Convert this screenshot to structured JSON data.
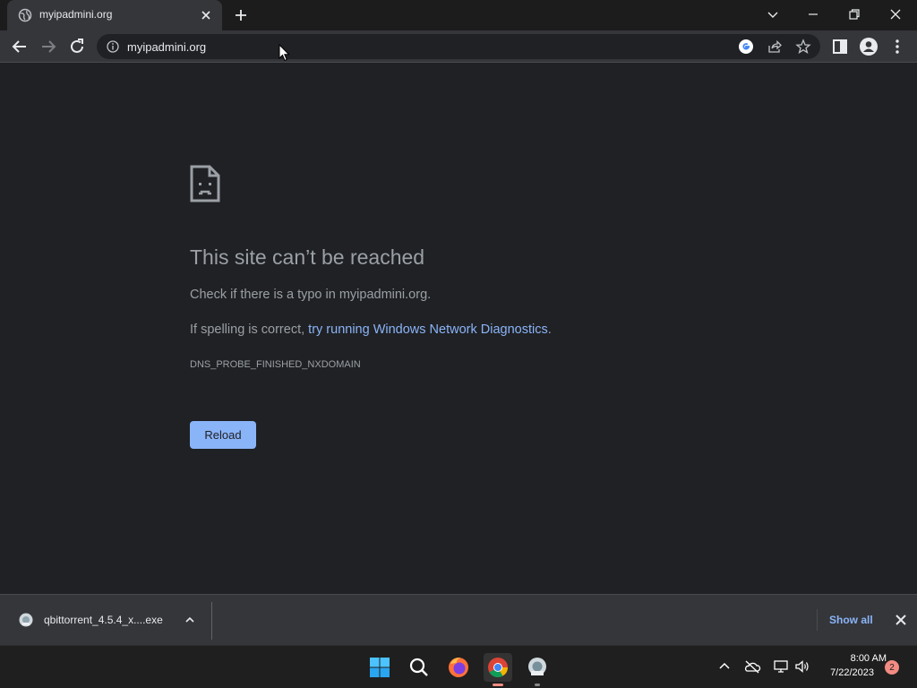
{
  "tab": {
    "title": "myipadmini.org",
    "favicon": "globe-icon",
    "close_icon": "close-icon"
  },
  "toolbar": {
    "url": "myipadmini.org",
    "icons": [
      "back-arrow-icon",
      "forward-arrow-icon",
      "reload-icon",
      "info-icon",
      "google-lens-icon",
      "share-icon",
      "star-icon",
      "side-panel-icon",
      "profile-icon",
      "kebab-menu-icon"
    ]
  },
  "error": {
    "title": "This site can’t be reached",
    "line1": "Check if there is a typo in myipadmini.org.",
    "line2_prefix": "If spelling is correct, ",
    "line2_link": "try running Windows Network Diagnostics",
    "line2_suffix": ".",
    "code": "DNS_PROBE_FINISHED_NXDOMAIN",
    "reload_label": "Reload"
  },
  "downloads": {
    "filename": "qbittorrent_4.5.4_x....exe",
    "show_all_label": "Show all"
  },
  "taskbar": {
    "apps": [
      "windows-start-icon",
      "search-icon",
      "firefox-icon",
      "chrome-icon",
      "setup-installer-icon"
    ],
    "time": "8:00 AM",
    "date": "7/22/2023",
    "notification_count": "2"
  },
  "colors": {
    "page_bg": "#202124",
    "toolbar_bg": "#35363a",
    "link": "#8ab4f8",
    "text_muted": "#9aa0a6",
    "badge": "#f28b82"
  }
}
